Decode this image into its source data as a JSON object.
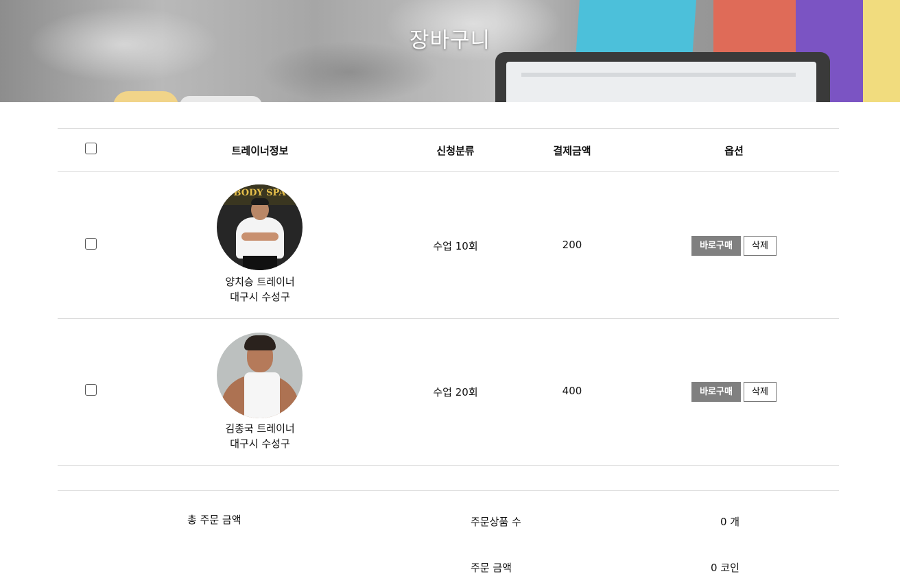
{
  "hero": {
    "title": "장바구니"
  },
  "cart": {
    "headers": {
      "trainer_info": "트레이너정보",
      "category": "신청분류",
      "price": "결제금액",
      "options": "옵션"
    },
    "items": [
      {
        "trainer_name": "양치승 트레이너",
        "location": "대구시 수성구",
        "category": "수업 10회",
        "price": "200",
        "buy_label": "바로구매",
        "delete_label": "삭제",
        "avatar_logo": "BODY SPA"
      },
      {
        "trainer_name": "김종국 트레이너",
        "location": "대구시 수성구",
        "category": "수업 20회",
        "price": "400",
        "buy_label": "바로구매",
        "delete_label": "삭제"
      }
    ]
  },
  "summary": {
    "total_label": "총 주문 금액",
    "count_label": "주문상품 수",
    "count_value": "0 개",
    "amount_label": "주문 금액",
    "amount_value": "0 코인"
  },
  "colors": {
    "buy_button": "#808080",
    "divider": "#dcdcdc",
    "title_text": "#ffffff"
  }
}
